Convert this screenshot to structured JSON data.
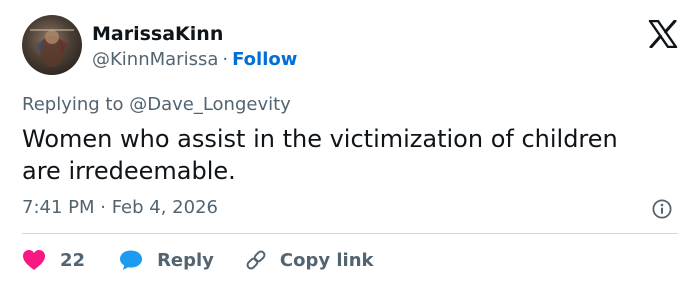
{
  "author": {
    "display_name": "MarissaKinn",
    "handle": "@KinnMarissa",
    "separator": "·",
    "follow_label": "Follow"
  },
  "reply": {
    "prefix": "Replying to ",
    "to_handle": "@Dave_Longevity"
  },
  "tweet": {
    "text_line1": "Women who assist in the victimization of children",
    "text_line2": "are irredeemable.",
    "timestamp": "7:41 PM · Feb 4, 2026"
  },
  "actions": {
    "like_count": "22",
    "reply_label": "Reply",
    "copy_link_label": "Copy link"
  },
  "colors": {
    "like": "#f91880",
    "reply": "#1d9bf0",
    "follow": "#006fd6",
    "secondary_text": "#536471"
  },
  "icons": {
    "brand": "x-logo-icon",
    "info": "info-icon",
    "like": "heart-icon",
    "reply": "speech-bubble-icon",
    "copy": "link-icon"
  }
}
